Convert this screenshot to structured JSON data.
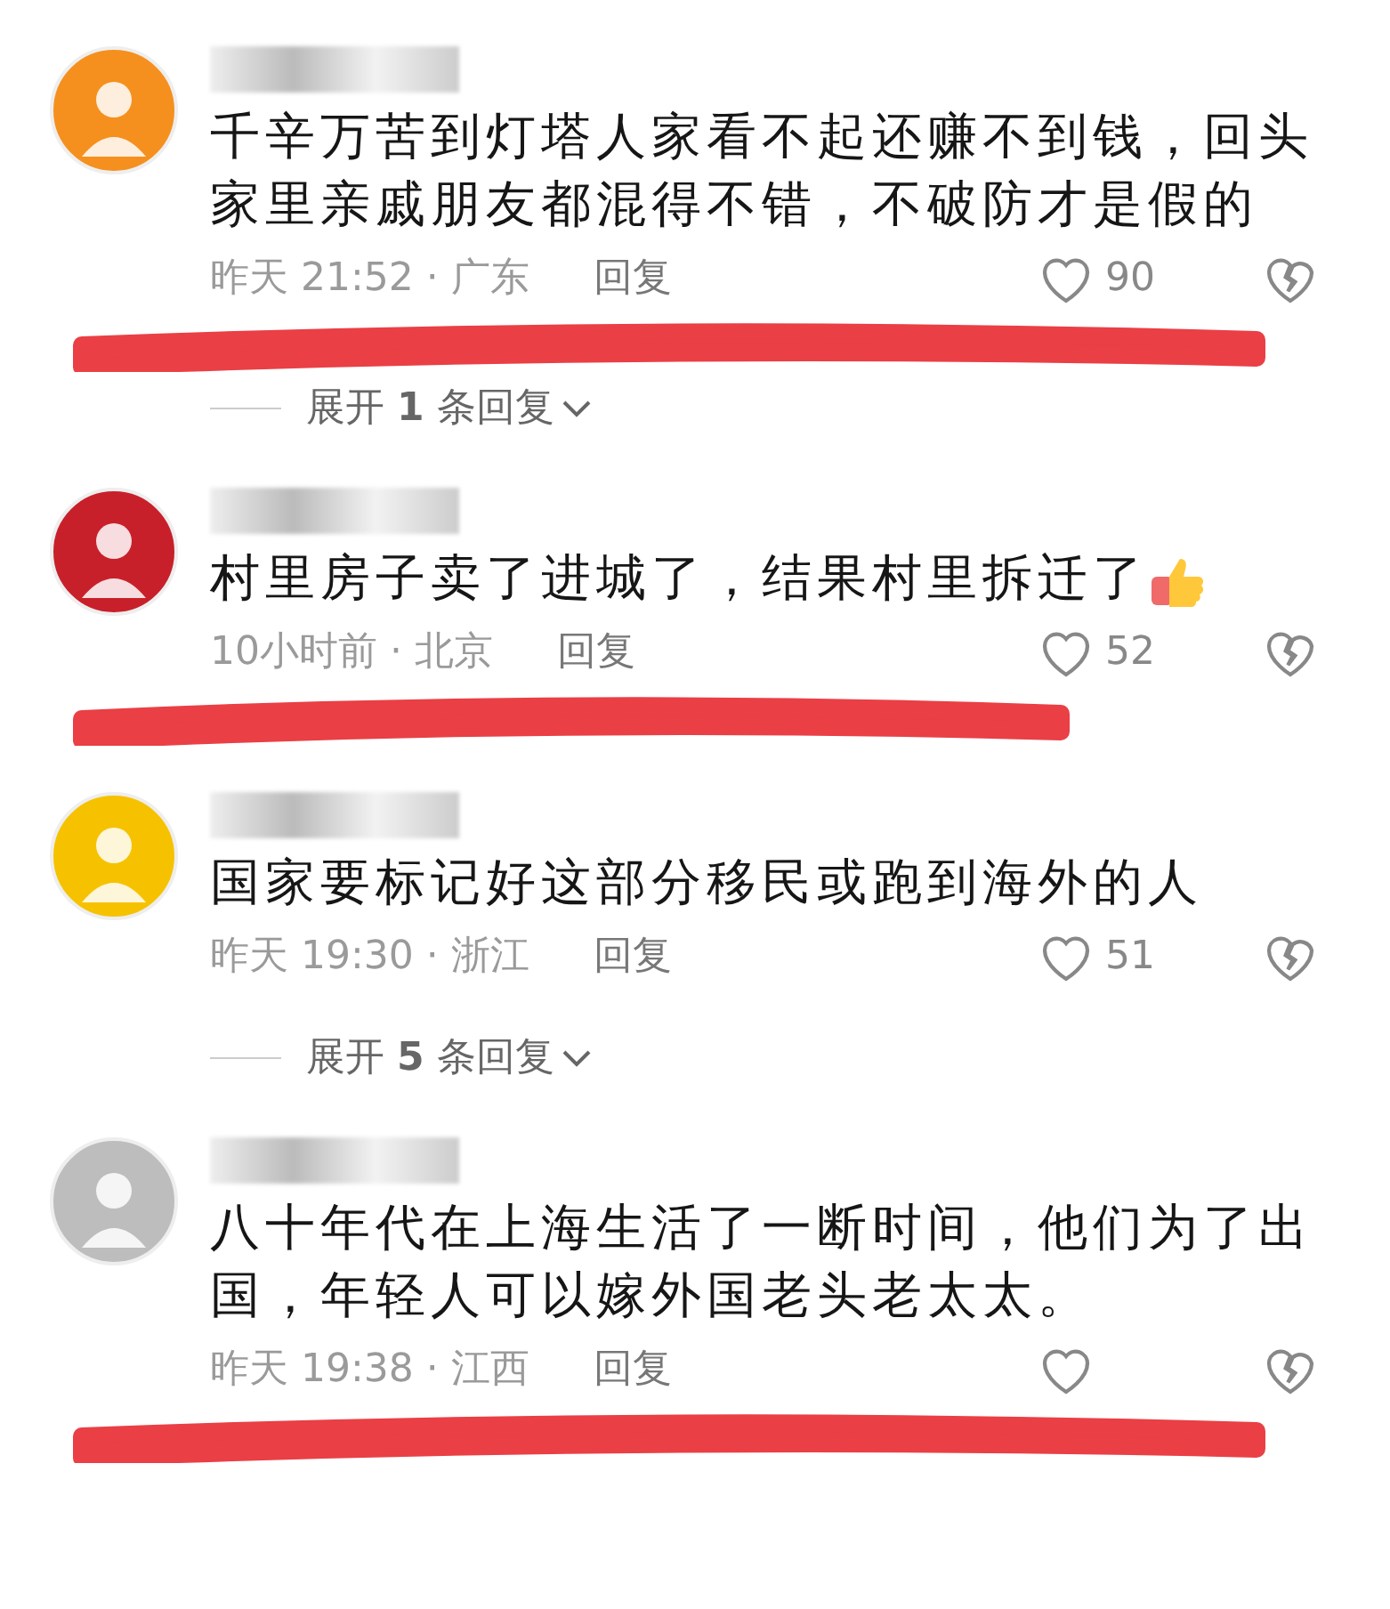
{
  "comments": [
    {
      "color": "#f5901e",
      "name_hidden": true,
      "text": "千辛万苦到灯塔人家看不起还赚不到钱，回头家里亲戚朋友都混得不错，不破防才是假的",
      "emoji_after": false,
      "meta": "昨天 21:52 · 广东",
      "reply": "回复",
      "likes": "90",
      "marked": true,
      "expand": "展开 **1** 条回复"
    },
    {
      "color": "#c8202a",
      "name_hidden": true,
      "text": "村里房子卖了进城了，结果村里拆迁了",
      "emoji_after": true,
      "meta": "10小时前 · 北京",
      "reply": "回复",
      "likes": "52",
      "marked": true
    },
    {
      "color": "#f6c200",
      "name_hidden": true,
      "text": "国家要标记好这部分移民或跑到海外的人",
      "emoji_after": false,
      "meta": "昨天 19:30 · 浙江",
      "reply": "回复",
      "likes": "51",
      "marked": false,
      "expand": "展开 **5** 条回复"
    },
    {
      "color": "#bdbdbd",
      "name_hidden": true,
      "text": "八十年代在上海生活了一断时间，他们为了出国，年轻人可以嫁外国老头老太太。",
      "emoji_after": false,
      "meta": "昨天 19:38 · 江西",
      "reply": "回复",
      "marked": true
    }
  ]
}
